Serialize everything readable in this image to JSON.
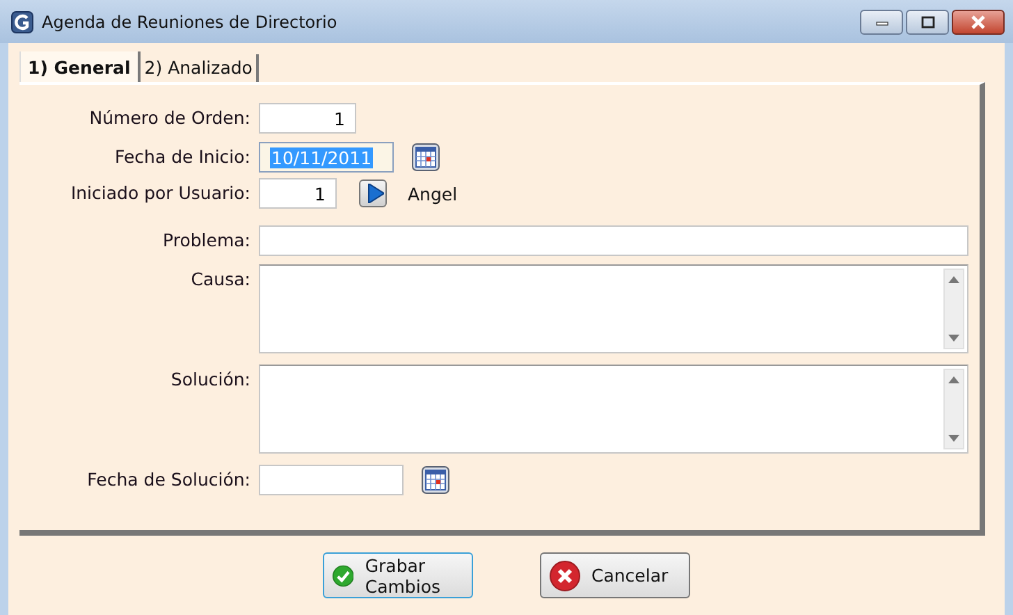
{
  "window": {
    "title": "Agenda de Reuniones de Directorio"
  },
  "tabs": [
    {
      "label": "1) General",
      "selected": true
    },
    {
      "label": "2) Analizado",
      "selected": false
    }
  ],
  "fields": [
    {
      "kind": "number",
      "label": "Número de Orden:",
      "value": "1"
    },
    {
      "kind": "date",
      "label": "Fecha de Inicio:",
      "value": "10/11/2011",
      "highlighted": true
    },
    {
      "kind": "user",
      "label": "Iniciado por Usuario:",
      "value": "1",
      "user_name": "Angel"
    },
    {
      "kind": "text",
      "label": "Problema:"
    },
    {
      "kind": "memo",
      "label": "Causa:"
    },
    {
      "kind": "memo",
      "label": "Solución:"
    },
    {
      "kind": "date",
      "label": "Fecha de Solución:",
      "highlighted": false
    }
  ],
  "buttons": [
    {
      "kind": "save",
      "label": "Grabar Cambios"
    },
    {
      "kind": "cancel",
      "label": "Cancelar"
    }
  ]
}
